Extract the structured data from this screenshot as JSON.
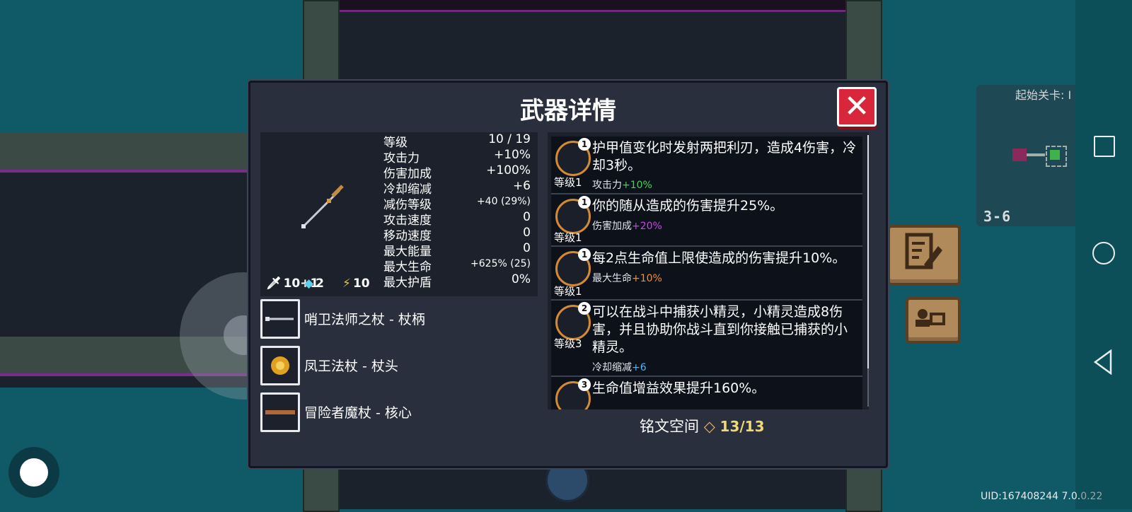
{
  "dialog": {
    "title": "武器详情",
    "close_label": "✕",
    "stats": [
      {
        "label": "等级",
        "value": "10 / 19"
      },
      {
        "label": "攻击力",
        "value": "+10%"
      },
      {
        "label": "伤害加成",
        "value": "+100%"
      },
      {
        "label": "冷却缩减",
        "value": "+6"
      },
      {
        "label": "减伤等级",
        "value": "+40 (29%)"
      },
      {
        "label": "攻击速度",
        "value": "0"
      },
      {
        "label": "移动速度",
        "value": "0"
      },
      {
        "label": "最大能量",
        "value": "0"
      },
      {
        "label": "最大生命",
        "value": "+625% (25)"
      },
      {
        "label": "最大护盾",
        "value": "0%"
      }
    ],
    "mini_stats": {
      "damage": "10+1",
      "energy": "2",
      "crit": "10"
    },
    "parts": [
      {
        "label": "哨卫法师之杖 - 杖柄",
        "icon": "staff-handle-icon"
      },
      {
        "label": "凤王法杖 - 杖头",
        "icon": "flower-head-icon"
      },
      {
        "label": "冒险者魔杖 - 核心",
        "icon": "wand-core-icon"
      }
    ],
    "inscriptions": [
      {
        "badge": "1",
        "level": "等级1",
        "text": "护甲值变化时发射两把利刃，造成4伤害，冷却3秒。",
        "sub_label": "攻击力",
        "sub_value": "+10%",
        "sub_color": "green",
        "icon": "shield-blade-icon"
      },
      {
        "badge": "1",
        "level": "等级1",
        "text": "你的随从造成的伤害提升25%。",
        "sub_label": "伤害加成",
        "sub_value": "+20%",
        "sub_color": "purple",
        "icon": "minion-icon"
      },
      {
        "badge": "1",
        "level": "等级1",
        "text": "每2点生命值上限使造成的伤害提升10%。",
        "sub_label": "最大生命",
        "sub_value": "+10%",
        "sub_color": "orange",
        "icon": "heart-icon"
      },
      {
        "badge": "2",
        "level": "等级3",
        "text": "可以在战斗中捕获小精灵，小精灵造成8伤害，并且协助你战斗直到你接触已捕获的小精灵。",
        "sub_label": "冷却缩减",
        "sub_value": "+6",
        "sub_color": "blue",
        "icon": "sprite-icon"
      },
      {
        "badge": "3",
        "level": "",
        "text": "生命值增益效果提升160%。",
        "sub_label": "",
        "sub_value": "",
        "sub_color": "green",
        "icon": "health-boost-icon"
      }
    ],
    "rune_space_label": "铭文空间",
    "rune_space_value": "13/13"
  },
  "minimap": {
    "title": "起始关卡: I",
    "level": "3-6"
  },
  "uid": {
    "main": "UID:167408244 7.0.",
    "dim": "0.22"
  },
  "colors": {
    "accent_red": "#d8263a",
    "panel": "#2a2f3d",
    "green": "#43d45a",
    "purple": "#c34adf",
    "orange": "#f0913a",
    "blue": "#4fb4ff",
    "gold": "#f0d872"
  }
}
